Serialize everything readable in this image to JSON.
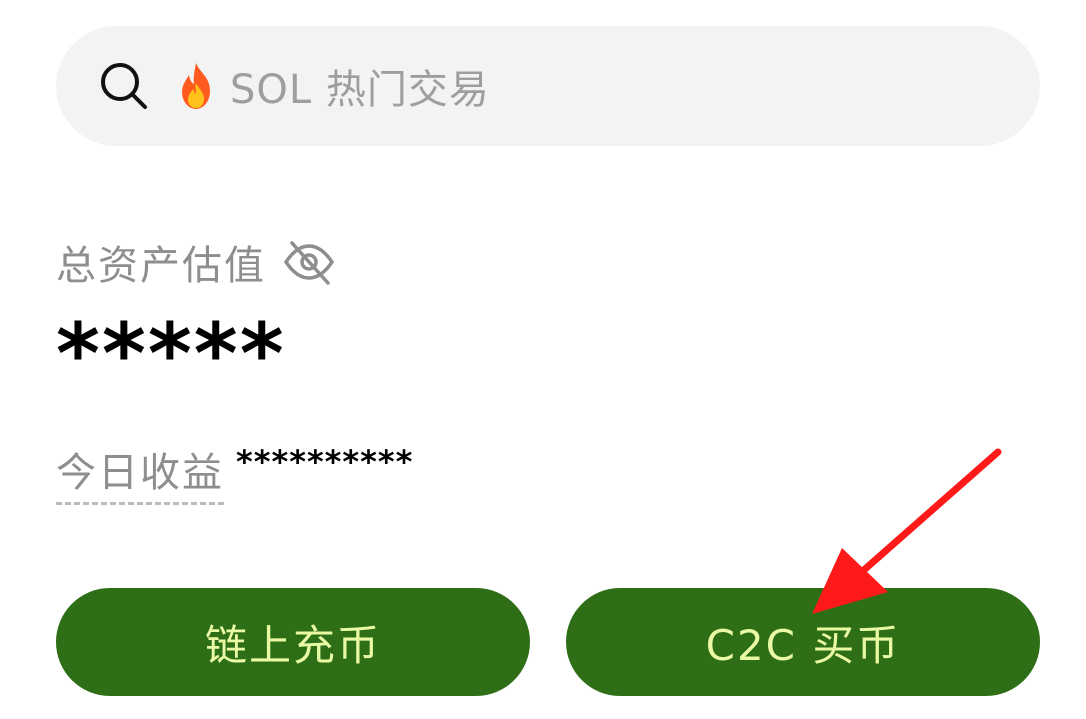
{
  "search": {
    "placeholder_text": "SOL 热门交易",
    "icon": "search-icon",
    "hot_icon": "fire-icon"
  },
  "assets": {
    "total_label": "总资产估值",
    "total_value": "*****",
    "visibility_icon": "eye-off-icon",
    "today_label": "今日收益",
    "today_value": "**********"
  },
  "actions": {
    "deposit_label": "链上充币",
    "buy_label": "C2C 买币"
  },
  "colors": {
    "button_bg": "#2d6e16",
    "button_text": "#e9f9a4",
    "search_bg": "#f3f3f3",
    "annotation_arrow": "#ff1a1a"
  }
}
